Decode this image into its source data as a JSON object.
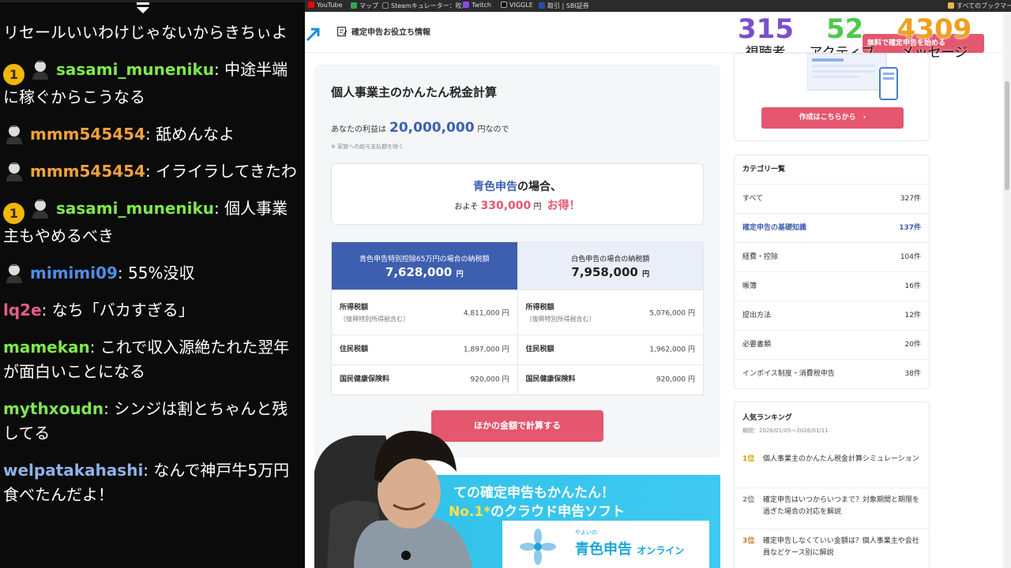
{
  "chat": {
    "messages": [
      {
        "badge": "",
        "avatar": false,
        "user": "",
        "user_color": "#ffffff",
        "text": "リセールいいわけじゃないからきちぃよ"
      },
      {
        "badge": "1",
        "avatar": true,
        "user": "sasami_muneniku",
        "user_color": "#7ee84f",
        "text": "中途半端に稼ぐからこうなる"
      },
      {
        "badge": "",
        "avatar": true,
        "user": "mmm545454",
        "user_color": "#f0a23c",
        "text": "舐めんなよ"
      },
      {
        "badge": "",
        "avatar": true,
        "user": "mmm545454",
        "user_color": "#f0a23c",
        "text": "イライラしてきたわ"
      },
      {
        "badge": "1",
        "avatar": true,
        "user": "sasami_muneniku",
        "user_color": "#7ee84f",
        "text": "個人事業主もやめるべき"
      },
      {
        "badge": "",
        "avatar": true,
        "user": "mimimi09",
        "user_color": "#4d8fe6",
        "text": "55%没収"
      },
      {
        "badge": "",
        "avatar": false,
        "user": "lq2e",
        "user_color": "#e85c8a",
        "text": "なち「バカすぎる」"
      },
      {
        "badge": "",
        "avatar": false,
        "user": "mamekan",
        "user_color": "#7ee84f",
        "text": "これで収入源絶たれた翌年が面白いことになる"
      },
      {
        "badge": "",
        "avatar": false,
        "user": "mythxoudn",
        "user_color": "#7ee84f",
        "text": "シンジは割とちゃんと残してる"
      },
      {
        "badge": "",
        "avatar": false,
        "user": "welpatakahashi",
        "user_color": "#8fb2e8",
        "text": "なんで神戸牛5万円食べたんだよ！"
      }
    ]
  },
  "bookmarks": {
    "items": [
      "YouTube",
      "マップ",
      "Steamキュレーター：吹...",
      "Twitch",
      "VIGGLE",
      "取引 | SBI証券"
    ],
    "all": "すべてのブックマーク"
  },
  "header": {
    "info_link": "確定申告お役立ち情報",
    "free_button": "無料で確定申告を始める"
  },
  "stats": [
    {
      "value": "315",
      "label": "視聴者",
      "color": "#7b4fcf"
    },
    {
      "value": "52",
      "label": "アクティブ",
      "color": "#4fc94f"
    },
    {
      "value": "4309",
      "label": "メッセージ",
      "color": "#f0a020"
    }
  ],
  "calc": {
    "title": "個人事業主のかんたん税金計算",
    "profit_prefix": "あなたの利益は",
    "profit_amount": "20,000,000",
    "profit_suffix": "円なので",
    "note": "※ 家族への給与支払額を除く",
    "save_blue": "青色申告",
    "save_rest": "の場合、",
    "save_about": "およそ",
    "save_amount": "330,000",
    "save_unit": "円",
    "save_gain": "お得！",
    "col_blue_title": "青色申告特別控除65万円の場合の納税額",
    "col_blue_total": "7,628,000",
    "col_white_title": "白色申告の場合の納税額",
    "col_white_total": "7,958,000",
    "yen": "円",
    "rows": [
      {
        "label": "所得税額",
        "sub": "（復興特別所得税含む）",
        "blue": "4,811,000 円",
        "white": "5,076,000 円"
      },
      {
        "label": "住民税額",
        "sub": "",
        "blue": "1,897,000 円",
        "white": "1,962,000 円"
      },
      {
        "label": "国民健康保険料",
        "sub": "",
        "blue": "920,000 円",
        "white": "920,000 円"
      }
    ],
    "recalc_button": "ほかの金額で計算する"
  },
  "banner": {
    "line1": "ての確定申告もかんたん！",
    "line2_no1": "No.1*",
    "line2_rest": "のクラウド申告ソフト",
    "card_small": "やよいの",
    "card_big": "青色申告",
    "card_online": "オンライン"
  },
  "promo": {
    "button": "作成はこちらから"
  },
  "categories": {
    "title": "カテゴリ一覧",
    "items": [
      {
        "name": "すべて",
        "count": "327件",
        "active": false
      },
      {
        "name": "確定申告の基礎知識",
        "count": "137件",
        "active": true
      },
      {
        "name": "経費・控除",
        "count": "104件",
        "active": false
      },
      {
        "name": "帳簿",
        "count": "16件",
        "active": false
      },
      {
        "name": "提出方法",
        "count": "12件",
        "active": false
      },
      {
        "name": "必要書類",
        "count": "20件",
        "active": false
      },
      {
        "name": "インボイス制度・消費税申告",
        "count": "38件",
        "active": false
      }
    ]
  },
  "ranking": {
    "title": "人気ランキング",
    "period": "期間：2026/01/05〜2026/01/11",
    "items": [
      {
        "pos": "1位",
        "color": "#c9a400",
        "text": "個人事業主のかんたん税金計算シミュレーション"
      },
      {
        "pos": "2位",
        "color": "#888888",
        "text": "確定申告はいつからいつまで？対象期間と期限を過ぎた場合の対応を解説"
      },
      {
        "pos": "3位",
        "color": "#c27a2c",
        "text": "確定申告しなくていい金額は？個人事業主や会社員などケース別に解説"
      }
    ]
  }
}
